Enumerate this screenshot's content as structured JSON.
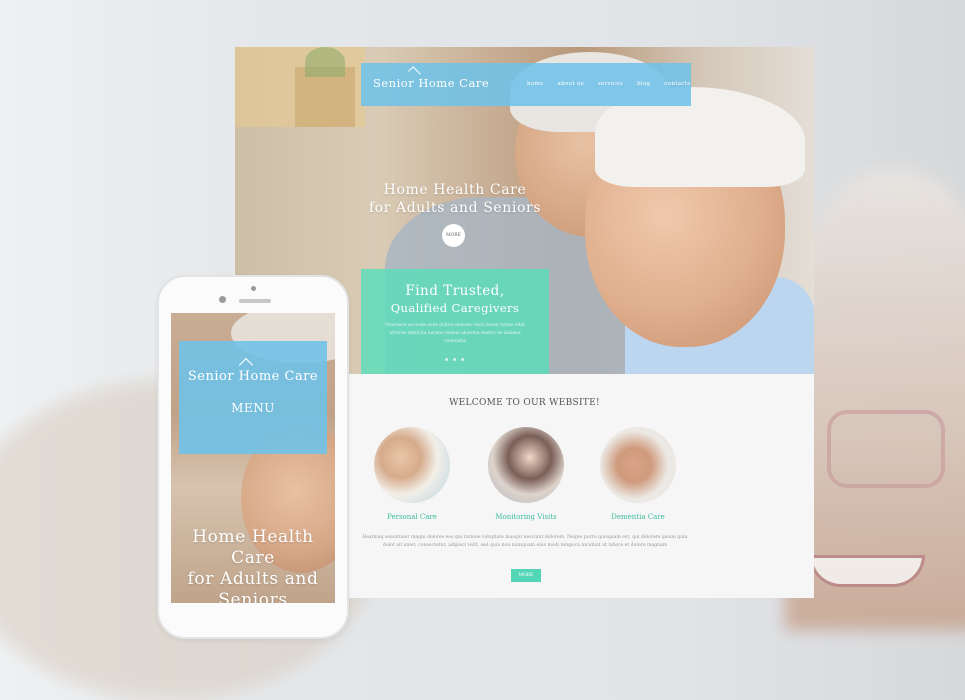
{
  "desktop": {
    "brand": "Senior Home Care",
    "nav": [
      "home",
      "about us",
      "services",
      "blog",
      "contacts"
    ],
    "hero": {
      "title_line1": "Home Health Care",
      "title_line2": "for Adults and Seniors",
      "more_label": "MORE"
    },
    "promo": {
      "title_line1": "Find Trusted,",
      "title_line2": "Qualified Caregivers",
      "text": "Nentasce accorde avez dolore massas vesti lorem tortas ellat ultrices dimicita loromo reibus ulcerma matris ee daluma venenatis"
    },
    "welcome_title": "WELCOME TO OUR WEBSITE!",
    "services": [
      {
        "label": "Personal Care",
        "image": "seniors-couple-photo"
      },
      {
        "label": "Monitoring Visits",
        "image": "caregiver-visit-photo"
      },
      {
        "label": "Dementia Care",
        "image": "cane-hands-photo"
      }
    ],
    "body_text": "Beatmaq seauntiaer magni dolores eos qui ratione voluptate masqui nesciunt dolorem. Neque porro quisquam est, qui dolorem ipsum quia dolor sit amet, consectetur, adipisci velit, sed quia non numquam eius modi tempora incidunt ut labore et dolore magnam",
    "more_button": "MORE"
  },
  "phone": {
    "brand": "Senior Home Care",
    "menu_label": "MENU",
    "title_line1": "Home Health",
    "title_line2": "Care",
    "title_line3": "for Adults and",
    "title_line4": "Seniors"
  },
  "colors": {
    "accent_blue": "#70c2e8",
    "accent_teal": "#5addba",
    "label_teal": "#3bbd9c"
  }
}
